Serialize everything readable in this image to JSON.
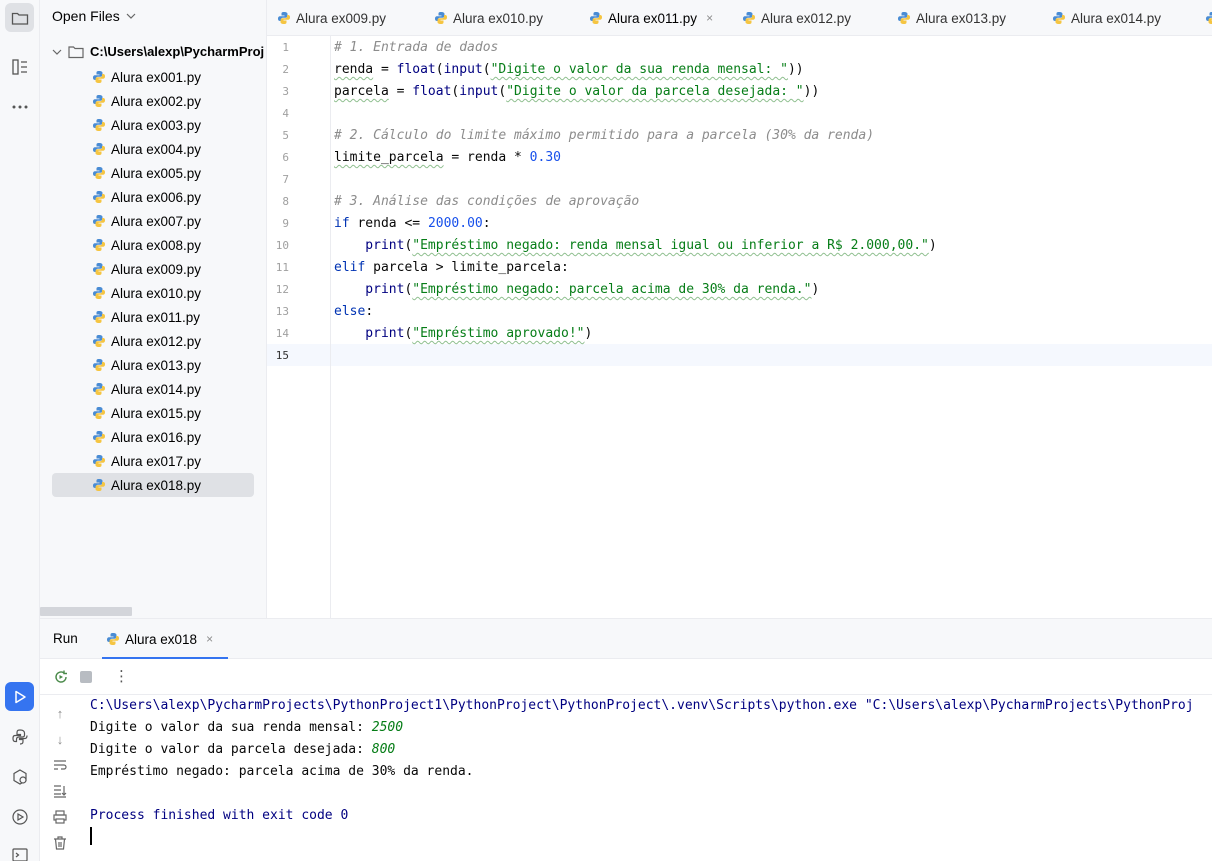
{
  "project_panel": {
    "header": "Open Files",
    "root": "C:\\Users\\alexp\\PycharmProj",
    "files": [
      "Alura ex001.py",
      "Alura ex002.py",
      "Alura ex003.py",
      "Alura ex004.py",
      "Alura ex005.py",
      "Alura ex006.py",
      "Alura ex007.py",
      "Alura ex008.py",
      "Alura ex009.py",
      "Alura ex010.py",
      "Alura ex011.py",
      "Alura ex012.py",
      "Alura ex013.py",
      "Alura ex014.py",
      "Alura ex015.py",
      "Alura ex016.py",
      "Alura ex017.py",
      "Alura ex018.py"
    ],
    "selected_file": "Alura ex018.py"
  },
  "tabs": [
    {
      "label": "Alura ex009.py"
    },
    {
      "label": "Alura ex010.py"
    },
    {
      "label": "Alura ex011.py",
      "active": true,
      "close": "×"
    },
    {
      "label": "Alura ex012.py"
    },
    {
      "label": "Alura ex013.py"
    },
    {
      "label": "Alura ex014.py"
    }
  ],
  "editor": {
    "line_numbers": [
      "1",
      "2",
      "3",
      "4",
      "5",
      "6",
      "7",
      "8",
      "9",
      "10",
      "11",
      "12",
      "13",
      "14",
      "15"
    ],
    "code": {
      "l1": "# 1. Entrada de dados",
      "l2a": "renda",
      "l2b": " = ",
      "l2c": "float",
      "l2d": "(",
      "l2e": "input",
      "l2f": "(",
      "l2g": "\"Digite o valor da sua renda mensal: \"",
      "l2h": "))",
      "l3a": "parcela",
      "l3b": " = ",
      "l3c": "float",
      "l3d": "(",
      "l3e": "input",
      "l3f": "(",
      "l3g": "\"Digite o valor da parcela desejada: \"",
      "l3h": "))",
      "l5": "# 2. Cálculo do limite máximo permitido para a parcela (30% da renda)",
      "l6a": "limite_parcela",
      "l6b": " = renda * ",
      "l6c": "0.30",
      "l8": "# 3. Análise das condições de aprovação",
      "l9a": "if",
      "l9b": " renda <= ",
      "l9c": "2000.00",
      "l9d": ":",
      "l10a": "    print",
      "l10b": "(",
      "l10c": "\"Empréstimo negado: renda mensal igual ou inferior a R$ 2.000,00.\"",
      "l10d": ")",
      "l11a": "elif",
      "l11b": " parcela > limite_parcela:",
      "l12a": "    print",
      "l12b": "(",
      "l12c": "\"Empréstimo negado: parcela acima de 30% da renda.\"",
      "l12d": ")",
      "l13a": "else",
      "l13b": ":",
      "l14a": "    print",
      "l14b": "(",
      "l14c": "\"Empréstimo aprovado!\"",
      "l14d": ")"
    }
  },
  "run_panel": {
    "title": "Run",
    "tab_label": "Alura ex018",
    "tab_close": "×",
    "console": {
      "cmd": "C:\\Users\\alexp\\PycharmProjects\\PythonProject1\\PythonProject\\PythonProject\\.venv\\Scripts\\python.exe \"C:\\Users\\alexp\\PycharmProjects\\PythonProj",
      "prompt1": "Digite o valor da sua renda mensal: ",
      "input1": "2500",
      "prompt2": "Digite o valor da parcela desejada: ",
      "input2": "800",
      "result": "Empréstimo negado: parcela acima de 30% da renda.",
      "exit": "Process finished with exit code 0"
    }
  },
  "colors": {
    "accent": "#3574f0",
    "keyword": "#0033b3",
    "string": "#067d17",
    "number": "#1750eb",
    "comment": "#8c8c8c"
  }
}
